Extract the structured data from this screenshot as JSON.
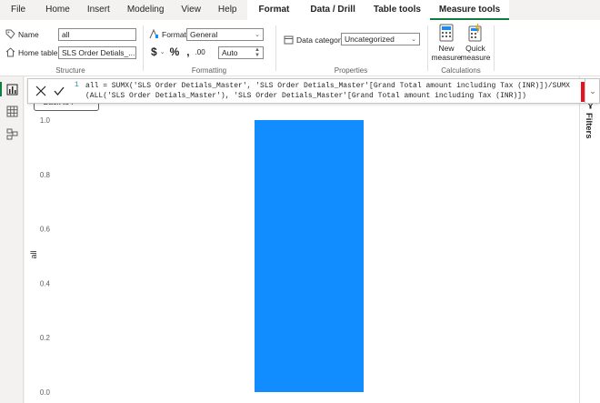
{
  "menubar": {
    "items": [
      {
        "label": "File",
        "style": "normal"
      },
      {
        "label": "Home",
        "style": "normal"
      },
      {
        "label": "Insert",
        "style": "normal"
      },
      {
        "label": "Modeling",
        "style": "normal"
      },
      {
        "label": "View",
        "style": "normal"
      },
      {
        "label": "Help",
        "style": "normal"
      },
      {
        "label": "Format",
        "style": "ctx"
      },
      {
        "label": "Data / Drill",
        "style": "ctx"
      },
      {
        "label": "Table tools",
        "style": "ctx"
      },
      {
        "label": "Measure tools",
        "style": "active"
      }
    ]
  },
  "ribbon": {
    "structure": {
      "label": "Structure",
      "name_label": "Name",
      "name_value": "all",
      "home_table_label": "Home table",
      "home_table_value": "SLS Order Detials_..."
    },
    "formatting": {
      "label": "Formatting",
      "format_label": "Format",
      "format_value": "General",
      "currency_symbol": "$",
      "percent_symbol": "%",
      "comma_symbol": ",",
      "decimal_symbol": ".00",
      "decimals_value": "Auto"
    },
    "properties": {
      "label": "Properties",
      "data_category_label": "Data category",
      "data_category_value": "Uncategorized"
    },
    "calculations": {
      "label": "Calculations",
      "new_measure_line1": "New",
      "new_measure_line2": "measure",
      "quick_measure_line1": "Quick",
      "quick_measure_line2": "measure"
    }
  },
  "formula_bar": {
    "line_number": "1",
    "code": "all = SUMX('SLS Order Detials_Master', 'SLS Order Detials_Master'[Grand Total amount including Tax (INR)])/SUMX(ALL('SLS Order Detials_Master'), 'SLS Order Detials_Master'[Grand Total amount including Tax (INR)])"
  },
  "back_button": {
    "label": "Back to r"
  },
  "filters_pane": {
    "label": "Filters"
  },
  "colors": {
    "accent": "#118dff",
    "active_tab": "#107c41"
  },
  "chart_data": {
    "type": "bar",
    "categories": [
      ""
    ],
    "values": [
      1.0
    ],
    "ylabel": "all",
    "ylim": [
      0,
      1.0
    ],
    "yticks": [
      "0.0",
      "0.2",
      "0.4",
      "0.6",
      "0.8",
      "1.0"
    ],
    "bar_color": "#118dff",
    "grid": false
  }
}
